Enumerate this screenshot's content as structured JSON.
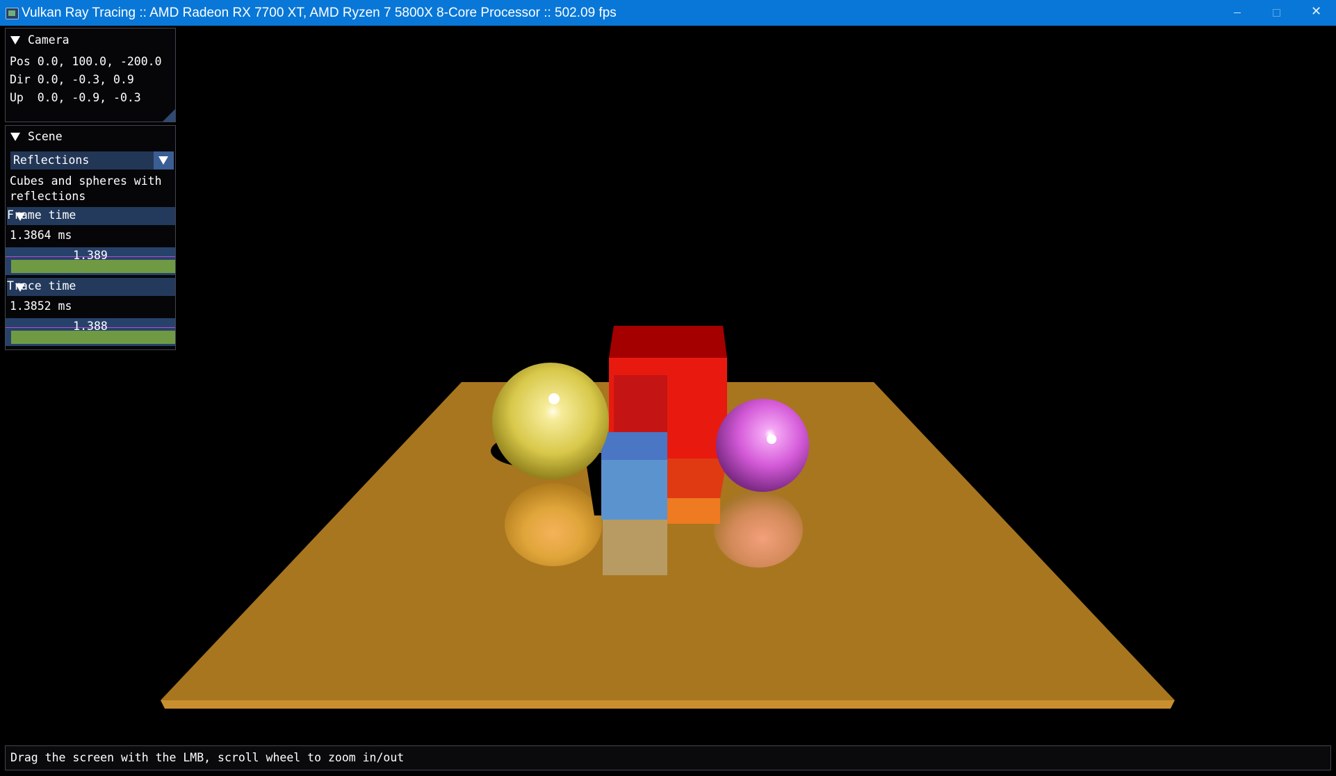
{
  "window": {
    "title": "Vulkan Ray Tracing :: AMD Radeon RX 7700 XT, AMD Ryzen 7 5800X 8-Core Processor :: 502.09 fps",
    "minimize_glyph": "",
    "maximize_glyph": "",
    "close_glyph": "✕"
  },
  "camera_panel": {
    "title": "Camera",
    "pos_line": "Pos 0.0, 100.0, -200.0",
    "dir_line": "Dir 0.0, -0.3, 0.9",
    "up_line": "Up  0.0, -0.9, -0.3"
  },
  "scene_panel": {
    "title": "Scene",
    "selected_scene": "Reflections",
    "description_line1": "Cubes and spheres with",
    "description_line2": "reflections",
    "frame_time": {
      "title": "Frame time",
      "value_text": "1.3864 ms",
      "plot_label": "1.389"
    },
    "trace_time": {
      "title": "Trace time",
      "value_text": "1.3852 ms",
      "plot_label": "1.388"
    }
  },
  "status_bar": {
    "hint": "Drag the screen with the LMB, scroll wheel to zoom in/out"
  },
  "colors": {
    "titlebar": "#0877d8",
    "panel_header": "#233a5c",
    "plot_fill": "#6f9a43",
    "floor": "#a8761f",
    "yellow_sphere": "#e8d86a",
    "pink_sphere": "#d855d8",
    "red_cube": "#e01a10",
    "blue_cube": "#5a8fd0"
  }
}
